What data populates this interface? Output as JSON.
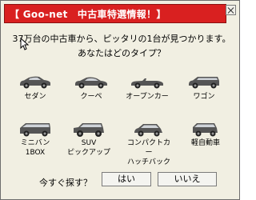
{
  "window": {
    "title": "【 Goo-net　中古車特選情報！】"
  },
  "message": {
    "line1": "37万台の中古車から、ピッタリの1台が見つかります。",
    "line2": "あなたはどのタイプ？"
  },
  "car_types": [
    {
      "label": "セダン",
      "icon": "sedan-icon"
    },
    {
      "label": "クーペ",
      "icon": "coupe-icon"
    },
    {
      "label": "オープンカー",
      "icon": "convertible-icon"
    },
    {
      "label": "ワゴン",
      "icon": "wagon-icon"
    },
    {
      "label": "ミニバン\n1BOX",
      "icon": "minivan-icon"
    },
    {
      "label": "SUV\nピックアップ",
      "icon": "suv-icon"
    },
    {
      "label": "コンパクトカー\nハッチバック",
      "icon": "hatchback-icon"
    },
    {
      "label": "軽自動車",
      "icon": "kei-car-icon"
    }
  ],
  "prompt": {
    "text": "今すぐ探す？",
    "yes_label": "はい",
    "no_label": "いいえ"
  },
  "colors": {
    "title_bg": "#d92020",
    "dialog_bg": "#f1efe2"
  }
}
